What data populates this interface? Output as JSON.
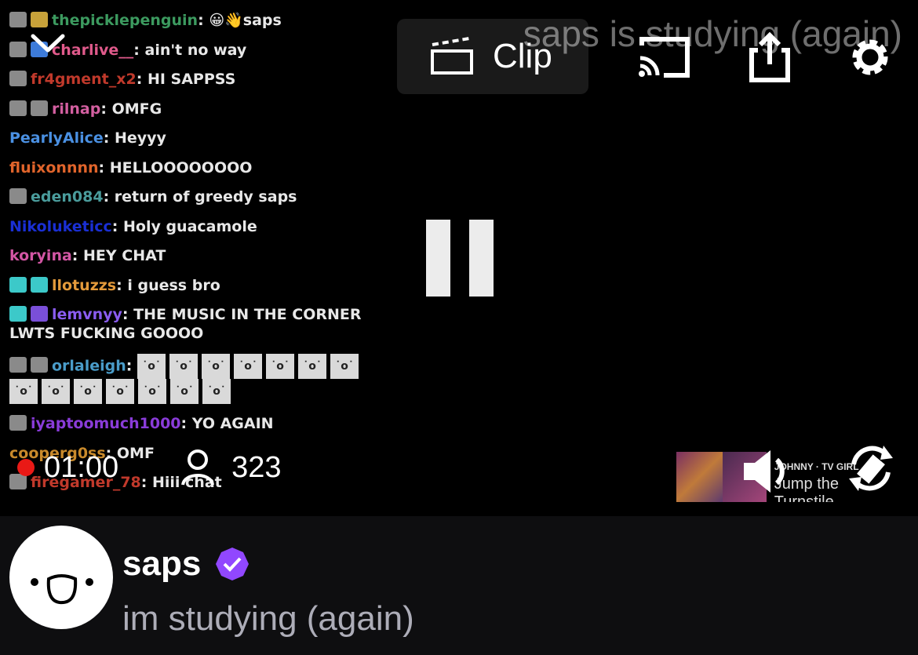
{
  "overlay_title": "saps is studying (again)",
  "clip_label": "Clip",
  "chat": [
    {
      "badges": [
        "grey",
        "gold"
      ],
      "user": "thepicklepenguin",
      "color": "#3c9a5f",
      "message": "saps",
      "emote_prefix": "😀👋"
    },
    {
      "badges": [
        "grey",
        "blue"
      ],
      "user": "charlive__",
      "color": "#e05a8b",
      "message": "ain't no way"
    },
    {
      "badges": [
        "grey"
      ],
      "user": "fr4gment_x2",
      "color": "#c0392b",
      "message": "HI SAPPSS"
    },
    {
      "badges": [
        "grey",
        "grey"
      ],
      "user": "rilnap",
      "color": "#d35fa0",
      "message": "OMFG"
    },
    {
      "badges": [],
      "user": "PearlyAlice",
      "color": "#4a90e2",
      "message": "Heyyy"
    },
    {
      "badges": [],
      "user": "fluixonnnn",
      "color": "#e0642b",
      "message": "HELLOOOOOOOO"
    },
    {
      "badges": [
        "grey"
      ],
      "user": "eden084",
      "color": "#4a9c9c",
      "message": "return of greedy saps"
    },
    {
      "badges": [],
      "user": "Nikoluketicc",
      "color": "#1a2fd4",
      "message": "Holy guacamole"
    },
    {
      "badges": [],
      "user": "koryina",
      "color": "#d356a4",
      "message": "HEY CHAT"
    },
    {
      "badges": [
        "teal",
        "teal"
      ],
      "user": "llotuzzs",
      "color": "#e39a3b",
      "message": "i guess bro"
    },
    {
      "badges": [
        "teal",
        "purple"
      ],
      "user": "lemvnyy",
      "color": "#8a5cf0",
      "message": "THE MUSIC IN THE CORNER LWTS FUCKING GOOOO"
    },
    {
      "badges": [
        "grey",
        "grey"
      ],
      "user": "orlaleigh",
      "color": "#4a9cc9",
      "message": "",
      "emote_count": 14
    },
    {
      "badges": [
        "grey"
      ],
      "user": "iyaptoomuch1000",
      "color": "#8a3cd9",
      "message": "YO AGAIN"
    },
    {
      "badges": [],
      "user": "cooperg0ss",
      "color": "#c98a2b",
      "message": "OMF"
    },
    {
      "badges": [
        "grey"
      ],
      "user": "firegamer_78",
      "color": "#c0392b",
      "message": "Hiii chat"
    }
  ],
  "stats": {
    "uptime": "01:00",
    "viewers": "323"
  },
  "music": {
    "artist": "JOHNNY · TV GIRL",
    "title": "Jump the Turnstile"
  },
  "channel": {
    "name": "saps",
    "title": "im studying (again)"
  },
  "colors": {
    "verified": "#9147ff",
    "live": "#e91916"
  }
}
